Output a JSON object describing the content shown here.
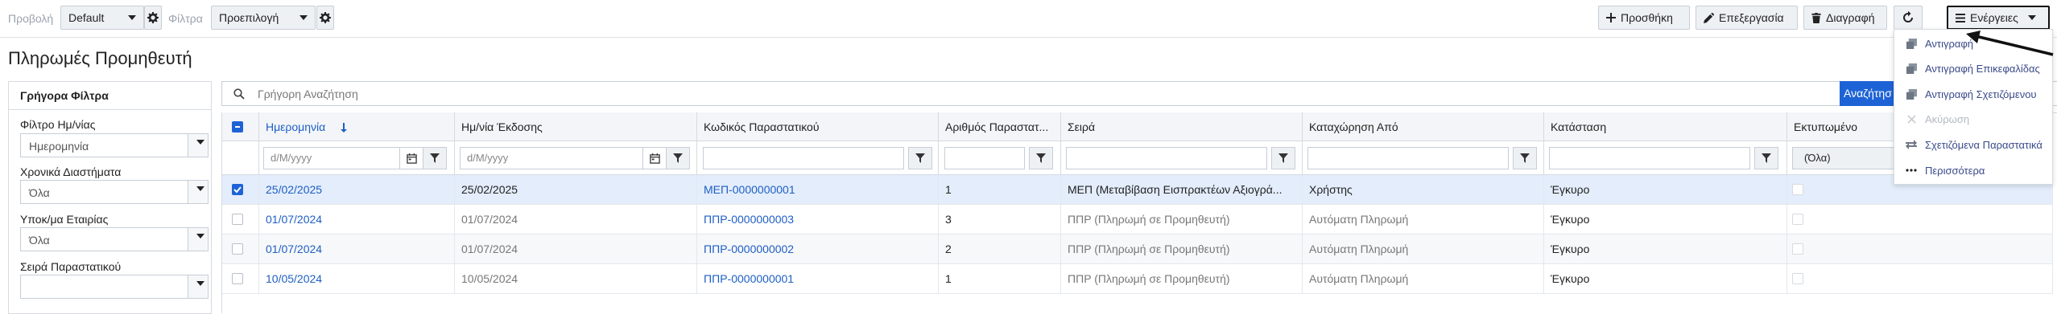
{
  "toolbar": {
    "view_label": "Προβολή",
    "view_value": "Default",
    "filters_label": "Φίλτρα",
    "filters_value": "Προεπιλογή",
    "add_label": "Προσθήκη",
    "edit_label": "Επεξεργασία",
    "delete_label": "Διαγραφή",
    "actions_label": "Ενέργειες"
  },
  "page_title": "Πληρωμές Προμηθευτή",
  "quick_filters": {
    "title": "Γρήγορα Φίλτρα",
    "fields": [
      {
        "label": "Φίλτρο Ημ/νίας",
        "value": "Ημερομηνία"
      },
      {
        "label": "Χρονικά Διαστήματα",
        "value": "Όλα"
      },
      {
        "label": "Υποκ/μα Εταιρίας",
        "value": "Όλα"
      },
      {
        "label": "Σειρά Παραστατικού",
        "value": ""
      }
    ]
  },
  "search": {
    "placeholder": "Γρήγορη Αναζήτηση",
    "button_label": "Αναζήτησ"
  },
  "grid": {
    "columns": [
      "Ημερομηνία",
      "Ημ/νία Έκδοσης",
      "Κωδικός Παραστατικού",
      "Αριθμός Παραστατ...",
      "Σειρά",
      "Καταχώρηση Από",
      "Κατάσταση",
      "Εκτυπωμένο"
    ],
    "date_placeholder": "d/M/yyyy",
    "printed_filter_value": "(Όλα)",
    "rows": [
      {
        "date": "25/02/2025",
        "issue_date": "25/02/2025",
        "code": "ΜΕΠ-0000000001",
        "number": "1",
        "series": "ΜΕΠ (Μεταβίβαση Εισπρακτέων Αξιογρά...",
        "created_by": "Χρήστης",
        "status": "Έγκυρο",
        "selected": true
      },
      {
        "date": "01/07/2024",
        "issue_date": "01/07/2024",
        "code": "ΠΠΡ-0000000003",
        "number": "3",
        "series": "ΠΠΡ (Πληρωμή σε Προμηθευτή)",
        "created_by": "Αυτόματη Πληρωμή",
        "status": "Έγκυρο",
        "selected": false
      },
      {
        "date": "01/07/2024",
        "issue_date": "01/07/2024",
        "code": "ΠΠΡ-0000000002",
        "number": "2",
        "series": "ΠΠΡ (Πληρωμή σε Προμηθευτή)",
        "created_by": "Αυτόματη Πληρωμή",
        "status": "Έγκυρο",
        "selected": false
      },
      {
        "date": "10/05/2024",
        "issue_date": "10/05/2024",
        "code": "ΠΠΡ-0000000001",
        "number": "1",
        "series": "ΠΠΡ (Πληρωμή σε Προμηθευτή)",
        "created_by": "Αυτόματη Πληρωμή",
        "status": "Έγκυρο",
        "selected": false
      }
    ]
  },
  "actions_menu": {
    "items": [
      {
        "label": "Αντιγραφή",
        "icon": "copy-icon",
        "disabled": false
      },
      {
        "label": "Αντιγραφή Επικεφαλίδας",
        "icon": "copy-icon",
        "disabled": false
      },
      {
        "label": "Αντιγραφή Σχετιζόμενου",
        "icon": "copy-icon",
        "disabled": false
      },
      {
        "label": "Ακύρωση",
        "icon": "cancel-icon",
        "disabled": true
      },
      {
        "label": "Σχετιζόμενα Παραστατικά",
        "icon": "related-icon",
        "disabled": false
      },
      {
        "label": "Περισσότερα",
        "icon": "more-icon",
        "disabled": false
      }
    ]
  },
  "colors": {
    "accent": "#1e63d6",
    "link": "#1e5fc4",
    "muted": "#9aa3ad",
    "header_bg": "#f3f5f8",
    "menu_text": "#3a4a8a"
  }
}
